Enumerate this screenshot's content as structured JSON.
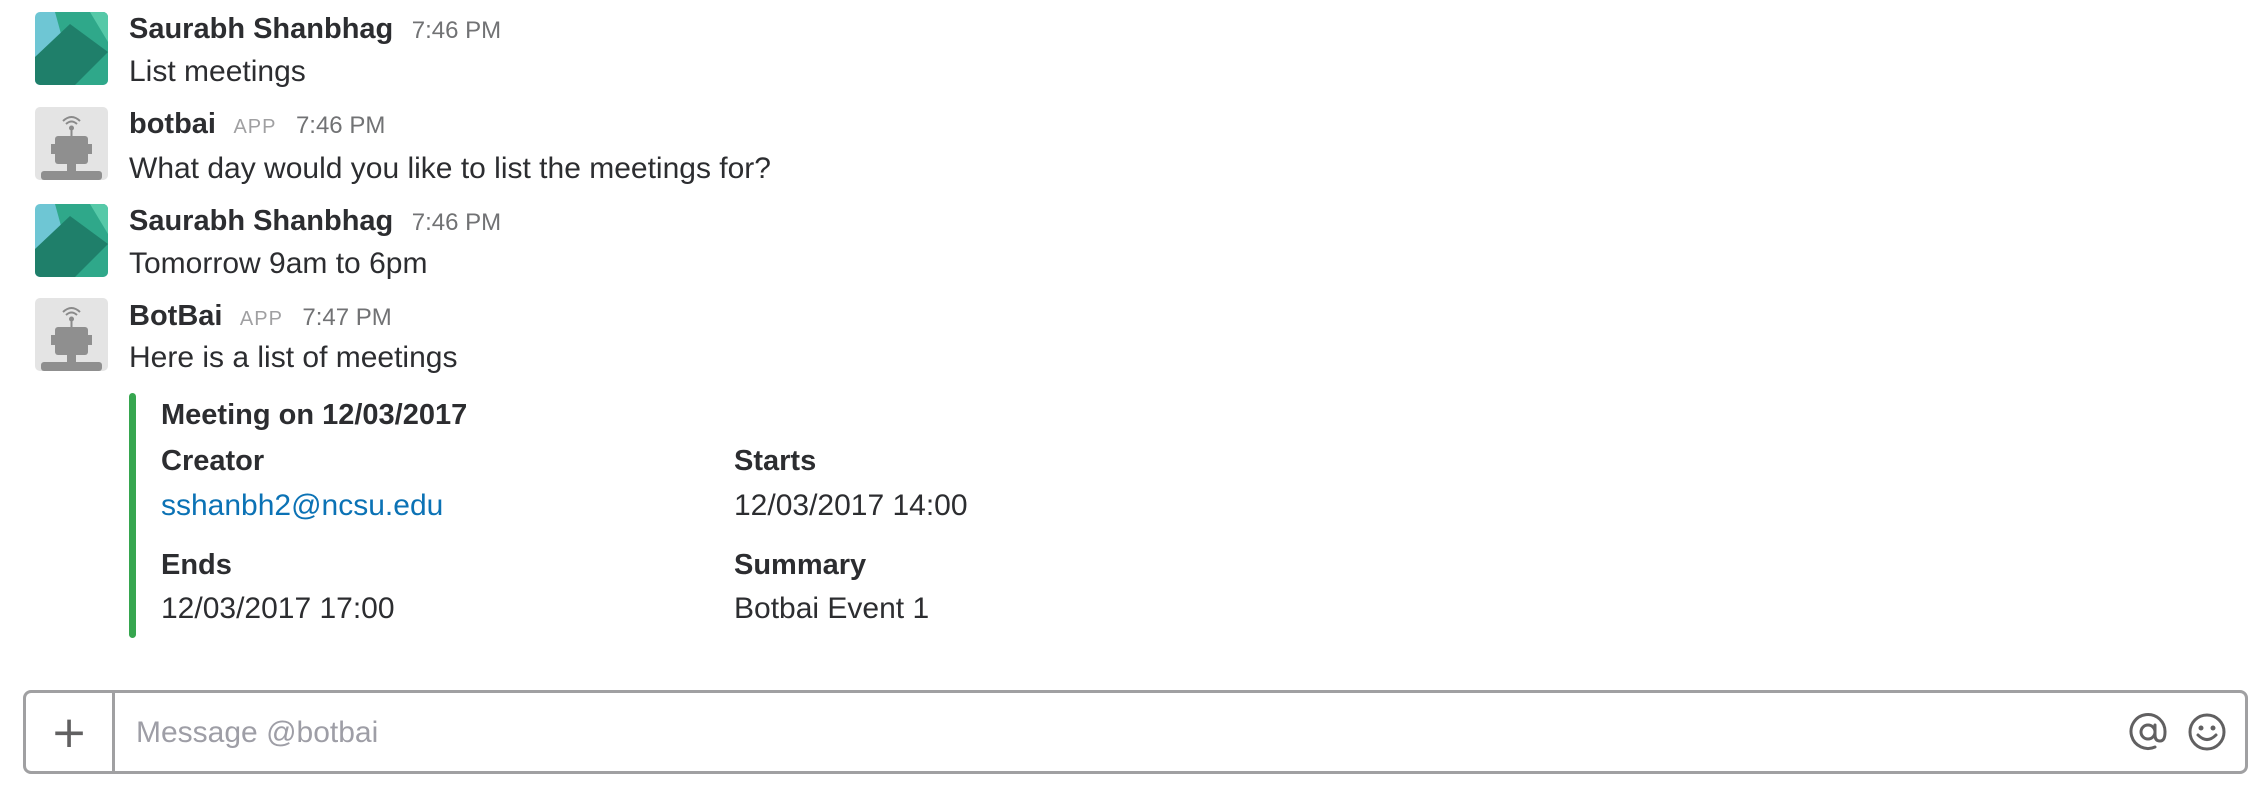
{
  "colors": {
    "attachment_bar": "#36a64f",
    "link": "#0b72b5",
    "author_text": "#2c2d30",
    "timestamp": "#717274"
  },
  "messages": [
    {
      "author": "Saurabh Shanbhag",
      "time": "7:46 PM",
      "text": "List meetings",
      "avatar": "user-avatar-geometric"
    },
    {
      "author": "botbai",
      "badge": "APP",
      "time": "7:46 PM",
      "text": "What day would you like to list the meetings for?",
      "avatar": "bot-avatar"
    },
    {
      "author": "Saurabh Shanbhag",
      "time": "7:46 PM",
      "text": "Tomorrow 9am to 6pm",
      "avatar": "user-avatar-geometric"
    },
    {
      "author": "BotBai",
      "badge": "APP",
      "time": "7:47 PM",
      "text": "Here is a list of meetings",
      "avatar": "bot-avatar"
    }
  ],
  "attachment": {
    "title": "Meeting on 12/03/2017",
    "fields": [
      {
        "title": "Creator",
        "value": "sshanbh2@ncsu.edu"
      },
      {
        "title": "Starts",
        "value": "12/03/2017 14:00"
      },
      {
        "title": "Ends",
        "value": "12/03/2017 17:00"
      },
      {
        "title": "Summary",
        "value": "Botbai Event 1"
      }
    ]
  },
  "composer": {
    "placeholder": "Message @botbai",
    "add_icon": "plus-icon",
    "mention_icon": "at-sign-icon",
    "emoji_icon": "smiley-icon"
  }
}
